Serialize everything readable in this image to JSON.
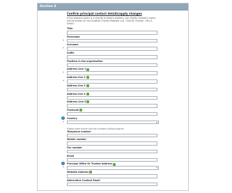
{
  "section": {
    "title": "Section 4"
  },
  "intro": {
    "heading": "Confirm principal contact details/apply changes",
    "note": "If the address given is a charity trustee's address, the charity trustee's name will be shown on the Scottish Charity Register e.g. 'Charity Trustee - Mrs A Smith'."
  },
  "fields": [
    {
      "label": "Title",
      "required": false
    },
    {
      "label": "Forename",
      "required": true
    },
    {
      "label": "Surname",
      "required": true
    },
    {
      "label": "Suffix",
      "required": false
    },
    {
      "label": "Position in the organisation",
      "required": false
    },
    {
      "label": "Address Line 1",
      "required": true,
      "icon": "edit-icon"
    },
    {
      "label": "Address line 2",
      "required": true,
      "icon": "edit-icon"
    },
    {
      "label": "Address line 3",
      "required": false,
      "icon": "edit-icon"
    },
    {
      "label": "Address line 4",
      "required": false,
      "icon": "edit-icon"
    },
    {
      "label": "Address Line 5",
      "required": false,
      "icon": "edit-icon"
    },
    {
      "label": "Postcode",
      "required": false,
      "icon": "edit-icon"
    }
  ],
  "country": {
    "label": "Country",
    "helptext": "Please enter phone and fax numbers without spaces."
  },
  "contact_fields": [
    {
      "label": "Telephone number"
    },
    {
      "label": "Mobile number"
    },
    {
      "label": "Fax number"
    },
    {
      "label": "Email"
    }
  ],
  "principal_office": {
    "label": "Principal Office Or Trustee Address"
  },
  "website": {
    "label": "Website Address"
  },
  "alt_email": {
    "label": "Alternative Contact Email"
  }
}
